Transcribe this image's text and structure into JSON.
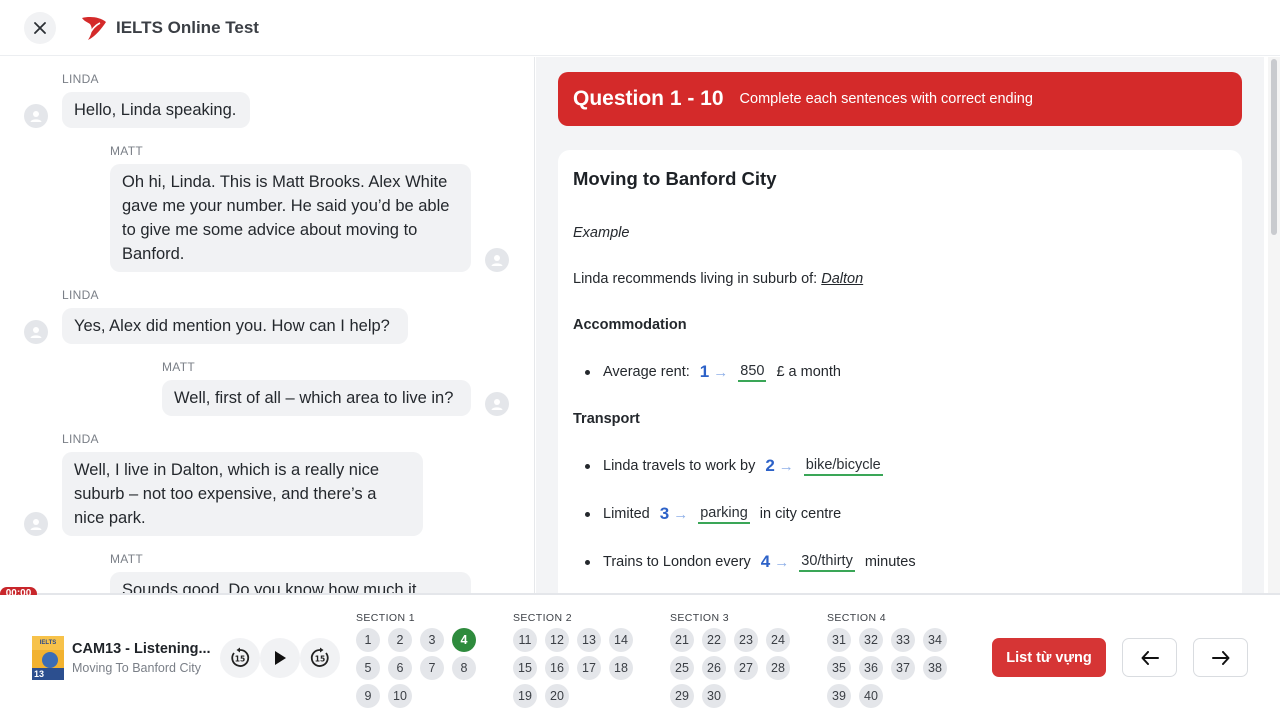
{
  "header": {
    "title": "IELTS Online Test"
  },
  "transcript": [
    {
      "speaker": "LINDA",
      "text": "Hello, Linda speaking."
    },
    {
      "speaker": "MATT",
      "text": "Oh hi, Linda. This is Matt Brooks. Alex White gave me your number. He said you’d be able to give me some advice about moving to Banford."
    },
    {
      "speaker": "LINDA",
      "text": "Yes, Alex did mention you. How can I help?"
    },
    {
      "speaker": "MATT",
      "text": "Well, first of all – which area to live in?"
    },
    {
      "speaker": "LINDA",
      "text": "Well, I live in Dalton, which is a really nice suburb – not too expensive, and there’s a nice park."
    },
    {
      "speaker": "MATT",
      "text": "Sounds good. Do you know how much it"
    }
  ],
  "question": {
    "title": "Question 1 - 10",
    "instruction": "Complete each sentences with correct ending",
    "card_title": "Moving to Banford City",
    "example_label": "Example",
    "example_text": "Linda recommends living in suburb of:",
    "example_answer": "Dalton",
    "sections": [
      {
        "heading": "Accommodation"
      },
      {
        "heading": "Transport"
      }
    ],
    "items": [
      {
        "before": "Average rent:",
        "num": "1",
        "answer": "850",
        "after": "£ a month"
      },
      {
        "before": "Linda travels to work by",
        "num": "2",
        "answer": "bike/bicycle",
        "after": ""
      },
      {
        "before": "Limited",
        "num": "3",
        "answer": "parking",
        "after": "in city centre"
      },
      {
        "before": "Trains to London every",
        "num": "4",
        "answer": "30/thirty",
        "after": "minutes"
      }
    ]
  },
  "player": {
    "time": "00:00",
    "track_title": "CAM13 - Listening...",
    "track_subtitle": "Moving To Banford City",
    "cover_label": "IELTS",
    "cover_number": "13"
  },
  "sections_nav": [
    {
      "label": "SECTION 1",
      "questions": [
        "1",
        "2",
        "3",
        "4",
        "5",
        "6",
        "7",
        "8",
        "9",
        "10"
      ]
    },
    {
      "label": "SECTION 2",
      "questions": [
        "11",
        "12",
        "13",
        "14",
        "15",
        "16",
        "17",
        "18",
        "19",
        "20"
      ]
    },
    {
      "label": "SECTION 3",
      "questions": [
        "21",
        "22",
        "23",
        "24",
        "25",
        "26",
        "27",
        "28",
        "29",
        "30"
      ]
    },
    {
      "label": "SECTION 4",
      "questions": [
        "31",
        "32",
        "33",
        "34",
        "35",
        "36",
        "37",
        "38",
        "39",
        "40"
      ]
    }
  ],
  "active_question": "4",
  "buttons": {
    "vocab": "List từ vựng"
  },
  "colors": {
    "accent_red": "#d42a2a",
    "answer_green": "#3aa657",
    "qnum_blue": "#2d62c8",
    "active_green": "#2e8b3d"
  }
}
